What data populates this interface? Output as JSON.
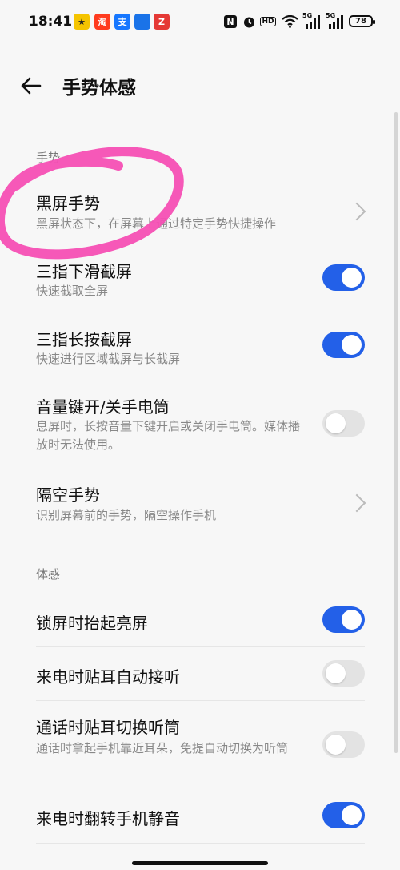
{
  "status": {
    "time": "18:41",
    "battery": "78",
    "network_5g": "5G",
    "hd": "HD",
    "nfc": "N",
    "notif_taobao": "淘",
    "notif_alipay": "支",
    "notif_app3": "",
    "notif_app4": "Z"
  },
  "header": {
    "title": "手势体感"
  },
  "sections": {
    "gesture": "手势",
    "motion": "体感"
  },
  "rows": {
    "black_screen": {
      "title": "黑屏手势",
      "sub": "黑屏状态下，在屏幕上通过特定手势快捷操作"
    },
    "three_down": {
      "title": "三指下滑截屏",
      "sub": "快速截取全屏",
      "on": true
    },
    "three_press": {
      "title": "三指长按截屏",
      "sub": "快速进行区域截屏与长截屏",
      "on": true
    },
    "volume_torch": {
      "title": "音量键开/关手电筒",
      "sub": "息屏时，长按音量下键开启或关闭手电筒。媒体播放时无法使用。",
      "on": false
    },
    "air_gesture": {
      "title": "隔空手势",
      "sub": "识别屏幕前的手势，隔空操作手机"
    },
    "raise_wake": {
      "title": "锁屏时抬起亮屏",
      "on": true
    },
    "ear_answer": {
      "title": "来电时贴耳自动接听",
      "on": false
    },
    "ear_switch": {
      "title": "通话时贴耳切换听筒",
      "sub": "通话时拿起手机靠近耳朵，免提自动切换为听筒",
      "on": false
    },
    "flip_mute": {
      "title": "来电时翻转手机静音",
      "on": true
    },
    "partial": {
      "title": ""
    }
  },
  "colors": {
    "toggle_on": "#2360e8",
    "toggle_off": "#e3e3e3",
    "annotation": "#f54fb4"
  },
  "icons": [
    "back-arrow-icon",
    "chevron-right-icon",
    "wifi-icon",
    "signal-icon",
    "alarm-icon"
  ]
}
